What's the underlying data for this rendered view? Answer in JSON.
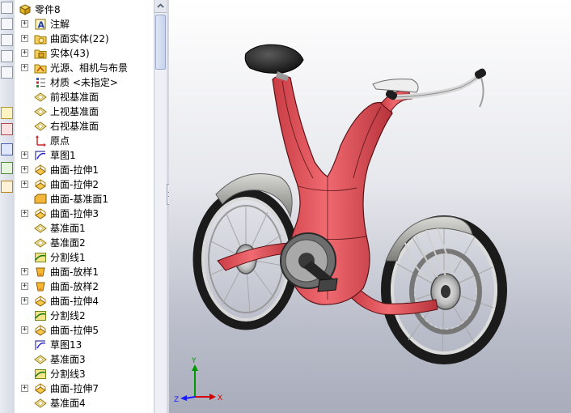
{
  "tree": {
    "root_label": "零件8",
    "items": [
      {
        "label": "注解",
        "icon": "annotation-icon",
        "expandable": true
      },
      {
        "label": "曲面实体(22)",
        "icon": "surface-bodies-folder-icon",
        "expandable": true
      },
      {
        "label": "实体(43)",
        "icon": "solid-bodies-folder-icon",
        "expandable": true
      },
      {
        "label": "光源、相机与布景",
        "icon": "lights-cameras-scenes-icon",
        "expandable": true
      },
      {
        "label": "材质 <未指定>",
        "icon": "material-icon",
        "expandable": false
      },
      {
        "label": "前视基准面",
        "icon": "plane-icon",
        "expandable": false
      },
      {
        "label": "上视基准面",
        "icon": "plane-icon",
        "expandable": false
      },
      {
        "label": "右视基准面",
        "icon": "plane-icon",
        "expandable": false
      },
      {
        "label": "原点",
        "icon": "origin-icon",
        "expandable": false
      },
      {
        "label": "草图1",
        "icon": "sketch-icon",
        "expandable": true
      },
      {
        "label": "曲面-拉伸1",
        "icon": "surface-extrude-icon",
        "expandable": true
      },
      {
        "label": "曲面-拉伸2",
        "icon": "surface-extrude-icon",
        "expandable": true
      },
      {
        "label": "曲面-基准面1",
        "icon": "planar-surface-icon",
        "expandable": false
      },
      {
        "label": "曲面-拉伸3",
        "icon": "surface-extrude-icon",
        "expandable": true
      },
      {
        "label": "基准面1",
        "icon": "plane-icon",
        "expandable": false
      },
      {
        "label": "基准面2",
        "icon": "plane-icon",
        "expandable": false
      },
      {
        "label": "分割线1",
        "icon": "split-line-icon",
        "expandable": false
      },
      {
        "label": "曲面-放样1",
        "icon": "surface-loft-icon",
        "expandable": true
      },
      {
        "label": "曲面-放样2",
        "icon": "surface-loft-icon",
        "expandable": true
      },
      {
        "label": "曲面-拉伸4",
        "icon": "surface-extrude-icon",
        "expandable": true
      },
      {
        "label": "分割线2",
        "icon": "split-line-icon",
        "expandable": false
      },
      {
        "label": "曲面-拉伸5",
        "icon": "surface-extrude-icon",
        "expandable": true
      },
      {
        "label": "草图13",
        "icon": "sketch-icon",
        "expandable": false
      },
      {
        "label": "基准面3",
        "icon": "plane-icon",
        "expandable": false
      },
      {
        "label": "分割线3",
        "icon": "split-line-icon",
        "expandable": false
      },
      {
        "label": "曲面-拉伸7",
        "icon": "surface-extrude-icon",
        "expandable": true
      },
      {
        "label": "基准面4",
        "icon": "plane-icon",
        "expandable": false
      }
    ]
  },
  "viewport": {
    "model": "bicycle-3d-model",
    "body_color": "#e8555c",
    "background_top": "#ffffff",
    "background_bottom": "#a9adbb"
  },
  "triad": {
    "axis_x_color": "#d40000",
    "axis_y_color": "#009a00",
    "axis_z_color": "#1a1aff"
  }
}
